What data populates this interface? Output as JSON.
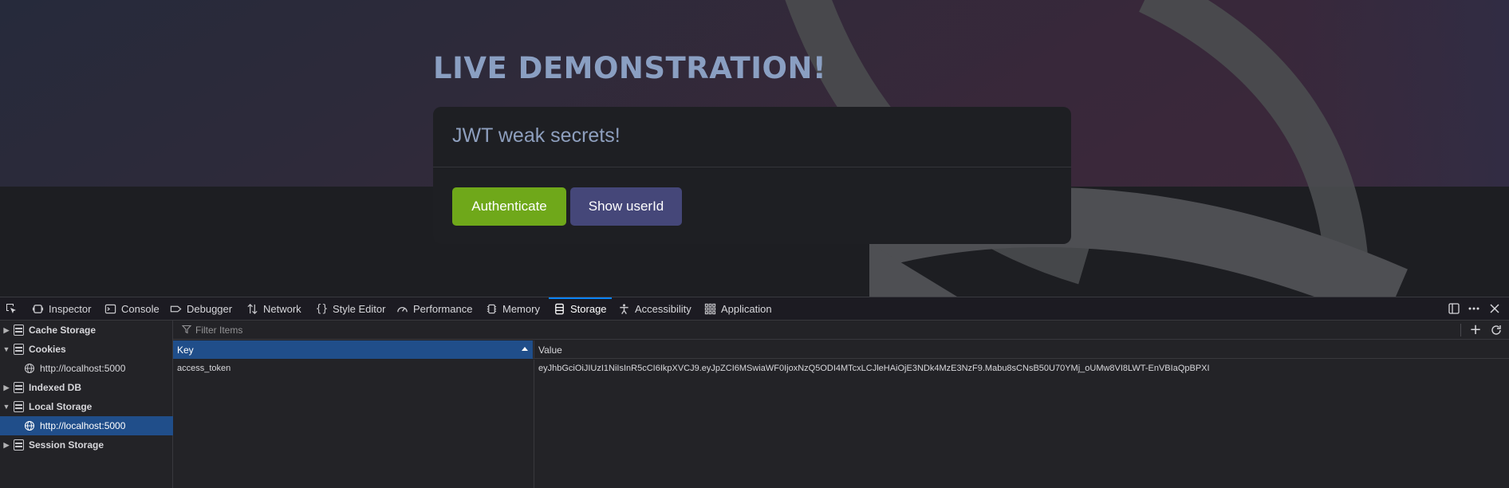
{
  "page": {
    "demo_title": "LIVE DEMONSTRATION!",
    "card_title": "JWT weak secrets!",
    "buttons": {
      "authenticate": "Authenticate",
      "show_userid": "Show userId"
    },
    "colors": {
      "authenticate": "#6fa81a",
      "show_userid": "#454779",
      "title": "#8a9fc2"
    }
  },
  "devtools": {
    "tabs": [
      {
        "label": "Inspector",
        "icon": "inspector-icon"
      },
      {
        "label": "Console",
        "icon": "console-icon"
      },
      {
        "label": "Debugger",
        "icon": "debugger-icon"
      },
      {
        "label": "Network",
        "icon": "network-icon"
      },
      {
        "label": "Style Editor",
        "icon": "style-editor-icon"
      },
      {
        "label": "Performance",
        "icon": "performance-icon"
      },
      {
        "label": "Memory",
        "icon": "memory-icon"
      },
      {
        "label": "Storage",
        "icon": "storage-icon",
        "active": true
      },
      {
        "label": "Accessibility",
        "icon": "accessibility-icon"
      },
      {
        "label": "Application",
        "icon": "application-icon"
      }
    ],
    "sidebar": [
      {
        "label": "Cache Storage",
        "type": "group",
        "expanded": false
      },
      {
        "label": "Cookies",
        "type": "group",
        "expanded": true
      },
      {
        "label": "http://localhost:5000",
        "type": "host"
      },
      {
        "label": "Indexed DB",
        "type": "group",
        "expanded": false
      },
      {
        "label": "Local Storage",
        "type": "group",
        "expanded": true
      },
      {
        "label": "http://localhost:5000",
        "type": "host",
        "selected": true
      },
      {
        "label": "Session Storage",
        "type": "group",
        "expanded": false
      }
    ],
    "filter": {
      "placeholder": "Filter Items"
    },
    "table": {
      "columns": [
        "Key",
        "Value"
      ],
      "rows": [
        {
          "key": "access_token",
          "value": "eyJhbGciOiJIUzI1NiIsInR5cCI6IkpXVCJ9.eyJpZCI6MSwiaWF0IjoxNzQ5ODI4MTcxLCJleHAiOjE3NDk4MzE3NzF9.Mabu8sCNsB50U70YMj_oUMw8VI8LWT-EnVBIaQpBPXI"
        }
      ]
    },
    "accent_color": "#0a84ff",
    "selection_color": "#204e8a"
  }
}
